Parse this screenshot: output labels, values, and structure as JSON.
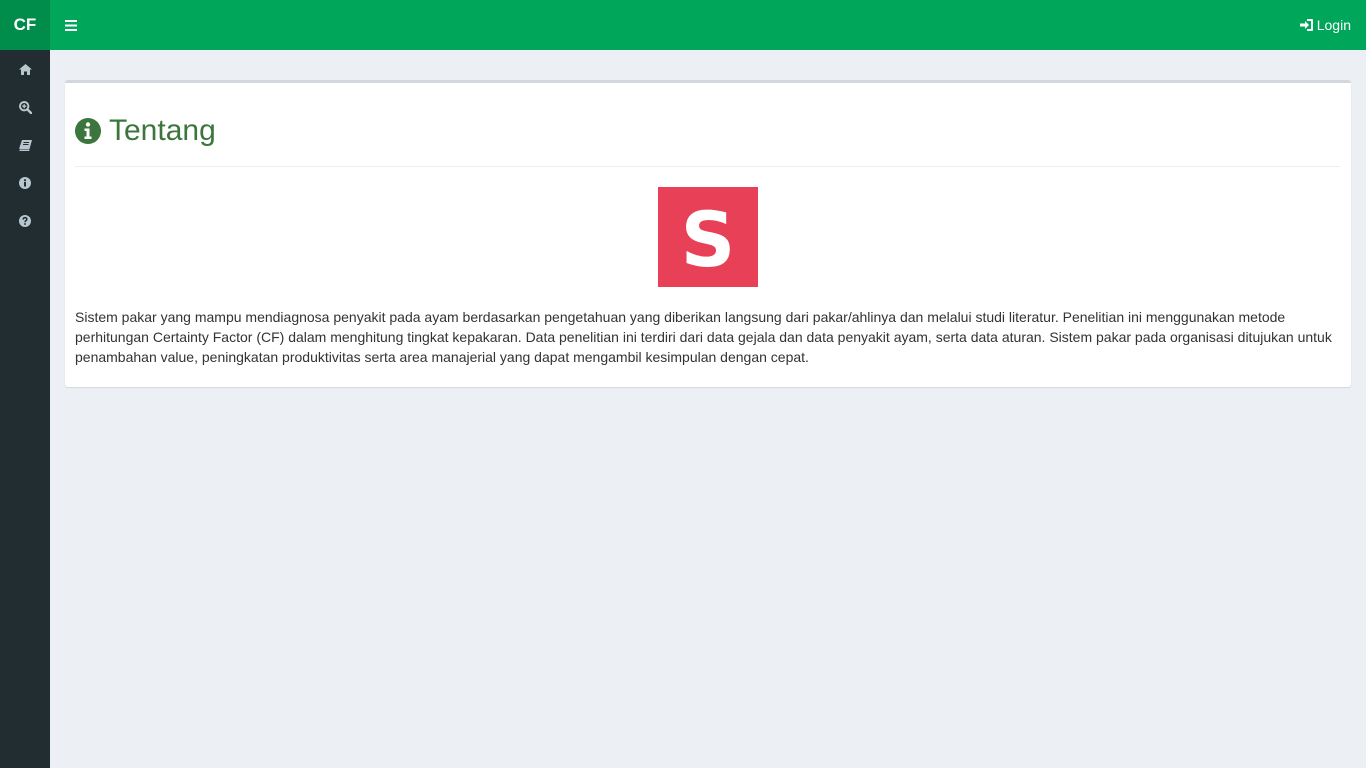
{
  "app": {
    "brand": "CF"
  },
  "header": {
    "login_label": "Login"
  },
  "sidebar": {
    "items": [
      {
        "icon": "home-icon"
      },
      {
        "icon": "zoom-in-icon"
      },
      {
        "icon": "book-icon"
      },
      {
        "icon": "info-icon"
      },
      {
        "icon": "help-icon"
      }
    ]
  },
  "page": {
    "title": "Tentang",
    "logo_letter": "S",
    "description": "Sistem pakar yang mampu mendiagnosa penyakit pada ayam berdasarkan pengetahuan yang diberikan langsung dari pakar/ahlinya dan melalui studi literatur. Penelitian ini menggunakan metode perhitungan Certainty Factor (CF) dalam menghitung tingkat kepakaran. Data penelitian ini terdiri dari data gejala dan data penyakit ayam, serta data aturan. Sistem pakar pada organisasi ditujukan untuk penambahan value, peningkatan produktivitas serta area manajerial yang dapat mengambil kesimpulan dengan cepat."
  },
  "colors": {
    "header": "#00a65a",
    "brand_bg": "#008d4c",
    "sidebar": "#222d32",
    "title": "#3c763d",
    "logo": "#e84057",
    "background": "#ecf0f5"
  }
}
